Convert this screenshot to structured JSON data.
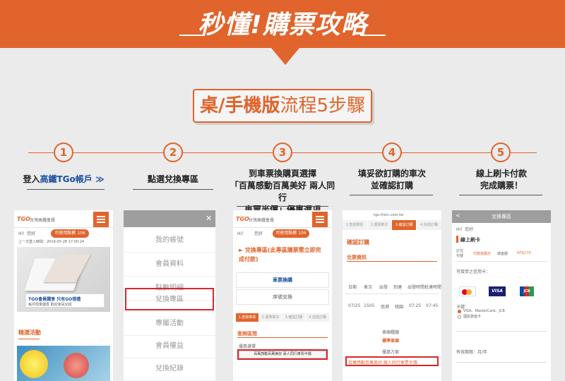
{
  "banner": {
    "title": "秒懂!購票攻略"
  },
  "subtitle": {
    "bold": "桌/手機版",
    "light": "流程5步驟"
  },
  "steps": [
    {
      "num": "1",
      "line1_pre": "登入",
      "line1_link": "高鐵TGo帳戶",
      "arrow": "≫"
    },
    {
      "num": "2",
      "line1": "點選兌換專區"
    },
    {
      "num": "3",
      "line1": "到車票換購頁選擇",
      "line2": "「百萬感動百萬美好 兩人同行",
      "line3": "車票半價」優惠選項"
    },
    {
      "num": "4",
      "line1": "填妥欲訂購的車次",
      "line2": "並確認訂購"
    },
    {
      "num": "5",
      "line1": "線上刷卡付款",
      "line2": "完成購票！"
    }
  ],
  "phone1": {
    "brand": "台灣高鐵會員",
    "logo": "TGO",
    "greeting": "Hi！您好",
    "points": "可使用點數 106",
    "last_login": "上一次登入時間：2019-05-28 17:00:24",
    "banner_text": "TGO會員獨享 只有GO想禮",
    "banner_sub": "每月限量優惠 歡迎會員兌換",
    "promo": "精選活動"
  },
  "phone2": {
    "close": "✕",
    "items": [
      "我的帳號",
      "會員資料",
      "點數明細",
      "兌換專區",
      "專屬活動",
      "會員權益",
      "兌換紀錄"
    ]
  },
  "phone3": {
    "brand": "台灣高鐵會員",
    "logo": "TGO",
    "greeting": "Hi！",
    "hello": "您好",
    "points": "可使用點數 106",
    "headline": "► 兌換專區(此專區購票需立即完成付款)",
    "opt1": "車票換購",
    "opt2": "序號兌換",
    "tabs": [
      "1.查詢車票",
      "2.選擇車次",
      "3.確認訂購",
      "4.完成訂購"
    ],
    "section": "查詢區間",
    "select_label": "優惠選擇",
    "select_value": "百萬感動百萬美好 兩人同行車票半價"
  },
  "phone4": {
    "url": "tgo.thsrc.com.tw",
    "tabs": [
      "1.查詢車票",
      "2.選擇車次",
      "3.確認訂購",
      "4.完成訂購"
    ],
    "title": "確認訂購",
    "section": "兌票資訊",
    "headers": [
      "日期",
      "車次",
      "出發",
      "到達",
      "出發時間",
      "抵達時間"
    ],
    "row": [
      "07/25",
      "1505",
      "南港",
      "桃園",
      "07:25",
      "07:45"
    ],
    "car_label": "車廂種類",
    "car_value": "標準車廂",
    "plan_label": "優惠方案",
    "plan_value": "百萬感動百萬美好 兩人同行車票半價"
  },
  "phone5": {
    "back": "<",
    "header": "兌換專區",
    "greeting": "Hi！您好",
    "section": "線上刷卡",
    "col1": "訂位代號",
    "col2": "付款後顯示",
    "col3": "總金額",
    "amount": "NT$170",
    "card_hint": "可接受之信用卡：",
    "card_label": "卡號：",
    "opt1": "VISA、MasterCard、JCB",
    "opt2": "國民旅遊卡",
    "expiry": "有效期限：月/年"
  },
  "colors": {
    "brand_orange": "#e0642b",
    "highlight_red": "#d9262c",
    "link_blue": "#1a4fa0"
  }
}
